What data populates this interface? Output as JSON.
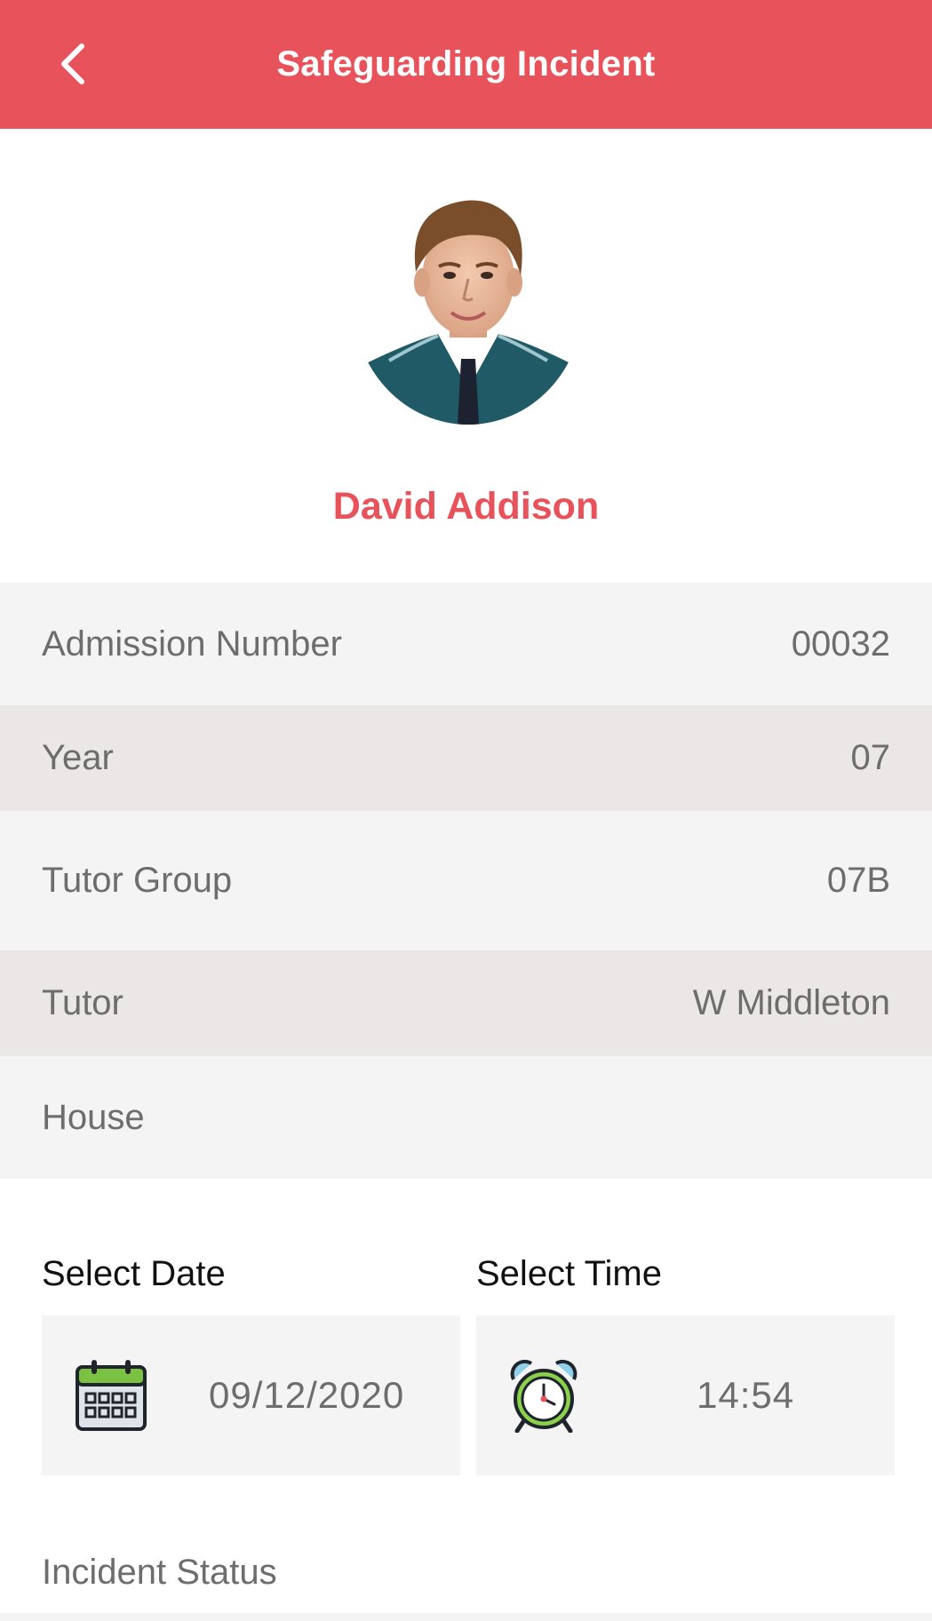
{
  "header": {
    "title": "Safeguarding Incident",
    "back_icon": "chevron-left-icon",
    "background": "#e8525a"
  },
  "student": {
    "name": "David Addison",
    "name_color": "#e8525a"
  },
  "details": [
    {
      "label": "Admission Number",
      "value": "00032"
    },
    {
      "label": "Year",
      "value": "07"
    },
    {
      "label": "Tutor Group",
      "value": "07B"
    },
    {
      "label": "Tutor",
      "value": "W Middleton"
    },
    {
      "label": "House",
      "value": ""
    }
  ],
  "date_picker": {
    "label": "Select Date",
    "value": "09/12/2020",
    "icon": "calendar-icon"
  },
  "time_picker": {
    "label": "Select Time",
    "value": "14:54",
    "icon": "alarm-clock-icon"
  },
  "incident_status": {
    "label": "Incident Status"
  }
}
